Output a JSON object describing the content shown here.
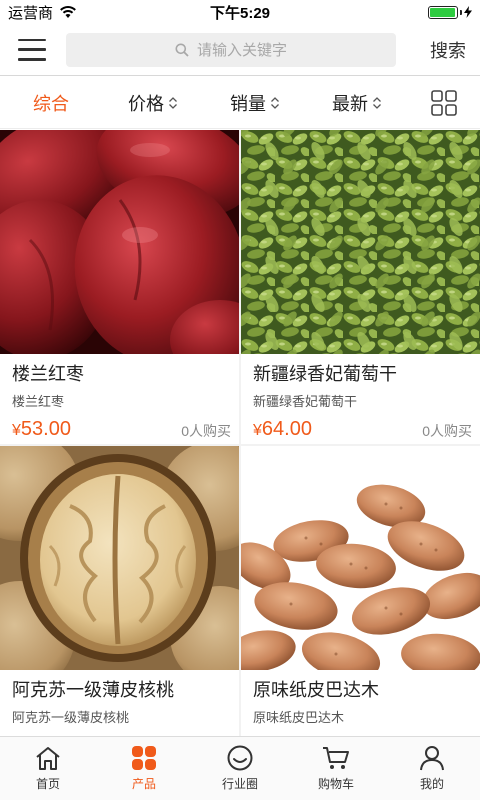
{
  "status": {
    "carrier": "运营商",
    "time": "下午5:29",
    "battery_level": 0.95
  },
  "top": {
    "search_placeholder": "请输入关键字",
    "search_label": "搜索"
  },
  "filters": {
    "items": [
      {
        "label": "综合",
        "active": true
      },
      {
        "label": "价格"
      },
      {
        "label": "销量"
      },
      {
        "label": "最新"
      }
    ],
    "layout_icon": "grid-view-icon"
  },
  "products": [
    {
      "name": "楼兰红枣",
      "subtitle": "楼兰红枣",
      "currency": "¥",
      "price": "53.00",
      "buyers": "0人购买",
      "image": "red-dates-photo"
    },
    {
      "name": "新疆绿香妃葡萄干",
      "subtitle": "新疆绿香妃葡萄干",
      "currency": "¥",
      "price": "64.00",
      "buyers": "0人购买",
      "image": "green-raisins-photo"
    },
    {
      "name": "阿克苏一级薄皮核桃",
      "subtitle": "阿克苏一级薄皮核桃",
      "image": "walnut-photo"
    },
    {
      "name": "原味纸皮巴达木",
      "subtitle": "原味纸皮巴达木",
      "image": "almond-photo"
    }
  ],
  "tabs": [
    {
      "label": "首页",
      "icon": "home-icon"
    },
    {
      "label": "产品",
      "icon": "products-icon",
      "active": true
    },
    {
      "label": "行业圈",
      "icon": "circle-icon"
    },
    {
      "label": "购物车",
      "icon": "cart-icon"
    },
    {
      "label": "我的",
      "icon": "user-icon"
    }
  ],
  "colors": {
    "accent": "#f05a1a",
    "text": "#222222",
    "muted": "#888888",
    "search_bg": "#eeeeee"
  }
}
